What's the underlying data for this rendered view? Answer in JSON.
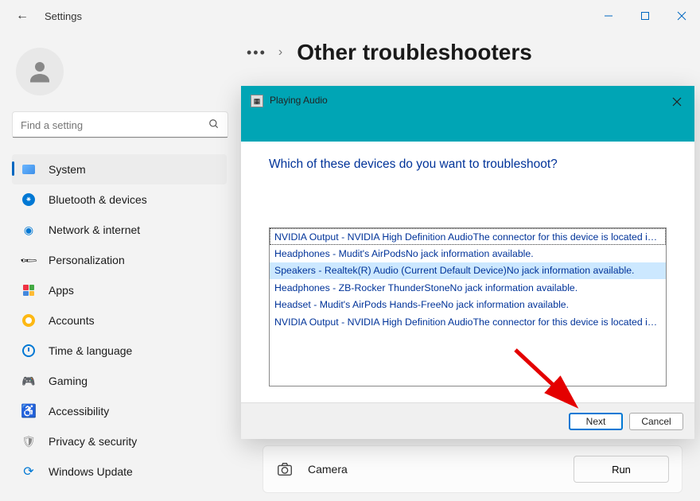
{
  "titlebar": {
    "app_name": "Settings"
  },
  "sidebar": {
    "search_placeholder": "Find a setting",
    "items": [
      {
        "label": "System"
      },
      {
        "label": "Bluetooth & devices"
      },
      {
        "label": "Network & internet"
      },
      {
        "label": "Personalization"
      },
      {
        "label": "Apps"
      },
      {
        "label": "Accounts"
      },
      {
        "label": "Time & language"
      },
      {
        "label": "Gaming"
      },
      {
        "label": "Accessibility"
      },
      {
        "label": "Privacy & security"
      },
      {
        "label": "Windows Update"
      }
    ]
  },
  "main": {
    "more": "•••",
    "chev": "›",
    "title": "Other troubleshooters",
    "row": {
      "label": "Camera",
      "run": "Run"
    }
  },
  "dialog": {
    "window_title": "Playing Audio",
    "heading": "Which of these devices do you want to troubleshoot?",
    "devices": [
      "NVIDIA Output - NVIDIA High Definition AudioThe connector for this device is located in t...",
      "Headphones - Mudit's AirPodsNo jack information available.",
      "Speakers - Realtek(R) Audio (Current Default Device)No jack information available.",
      "Headphones - ZB-Rocker ThunderStoneNo jack information available.",
      "Headset - Mudit's AirPods Hands-FreeNo jack information available.",
      "NVIDIA Output - NVIDIA High Definition AudioThe connector for this device is located in t..."
    ],
    "next": "Next",
    "cancel": "Cancel"
  }
}
